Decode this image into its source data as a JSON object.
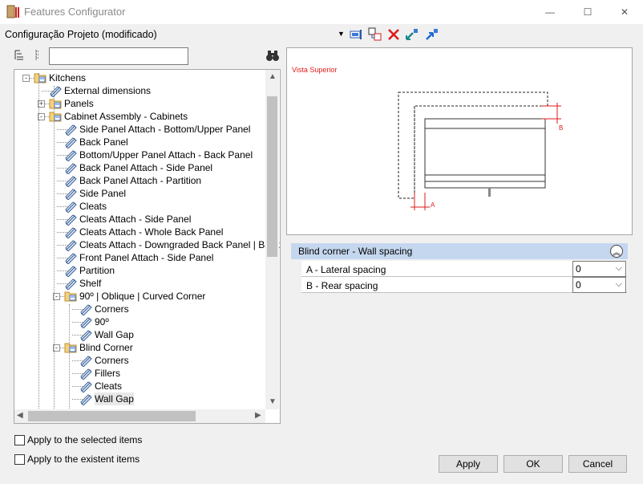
{
  "window": {
    "title": "Features Configurator",
    "controls": {
      "minimize": "—",
      "maximize": "☐",
      "close": "✕"
    }
  },
  "toolbar": {
    "configuration_label": "Configuração Projeto (modificado)",
    "dropdown_glyph": "▼",
    "icons": [
      "sync-icon",
      "assign-icon",
      "delete-icon",
      "import-icon",
      "export-icon"
    ]
  },
  "tree": {
    "rows": [
      {
        "label": "Kitchens",
        "icon": "folder"
      },
      {
        "label": "External dimensions",
        "icon": "feature"
      },
      {
        "label": "Panels",
        "icon": "folder"
      },
      {
        "label": "Cabinet Assembly - Cabinets",
        "icon": "folder"
      },
      {
        "label": "Side Panel Attach - Bottom/Upper Panel",
        "icon": "feature"
      },
      {
        "label": "Back Panel",
        "icon": "feature"
      },
      {
        "label": " Bottom/Upper Panel Attach - Back Panel",
        "icon": "feature"
      },
      {
        "label": "Back Panel Attach - Side Panel",
        "icon": "feature"
      },
      {
        "label": "Back Panel Attach - Partition",
        "icon": "feature"
      },
      {
        "label": "Side Panel",
        "icon": "feature"
      },
      {
        "label": "Cleats",
        "icon": "feature"
      },
      {
        "label": "Cleats Attach - Side Panel",
        "icon": "feature"
      },
      {
        "label": "Cleats Attach - Whole Back Panel",
        "icon": "feature"
      },
      {
        "label": "Cleats Attach - Downgraded Back Panel | Back",
        "icon": "feature"
      },
      {
        "label": "Front Panel Attach - Side Panel",
        "icon": "feature"
      },
      {
        "label": "Partition",
        "icon": "feature"
      },
      {
        "label": "Shelf",
        "icon": "feature"
      },
      {
        "label": "90º | Oblique | Curved Corner",
        "icon": "folder"
      },
      {
        "label": "Corners",
        "icon": "feature"
      },
      {
        "label": "90º",
        "icon": "feature"
      },
      {
        "label": "Wall Gap",
        "icon": "feature"
      },
      {
        "label": "Blind Corner",
        "icon": "folder"
      },
      {
        "label": "Corners",
        "icon": "feature"
      },
      {
        "label": "Fillers",
        "icon": "feature"
      },
      {
        "label": "Cleats",
        "icon": "feature"
      },
      {
        "label": "Wall Gap",
        "icon": "feature"
      }
    ]
  },
  "preview": {
    "title": "Vista Superior",
    "label_a": "A",
    "label_b": "B"
  },
  "properties": {
    "group_title": "Blind corner - Wall spacing",
    "rows": [
      {
        "label": "A - Lateral spacing",
        "value": "0"
      },
      {
        "label": "B - Rear spacing",
        "value": "0"
      }
    ]
  },
  "options": {
    "apply_selected": "Apply to the selected items",
    "apply_existent": "Apply to the existent items"
  },
  "buttons": {
    "apply": "Apply",
    "ok": "OK",
    "cancel": "Cancel"
  }
}
